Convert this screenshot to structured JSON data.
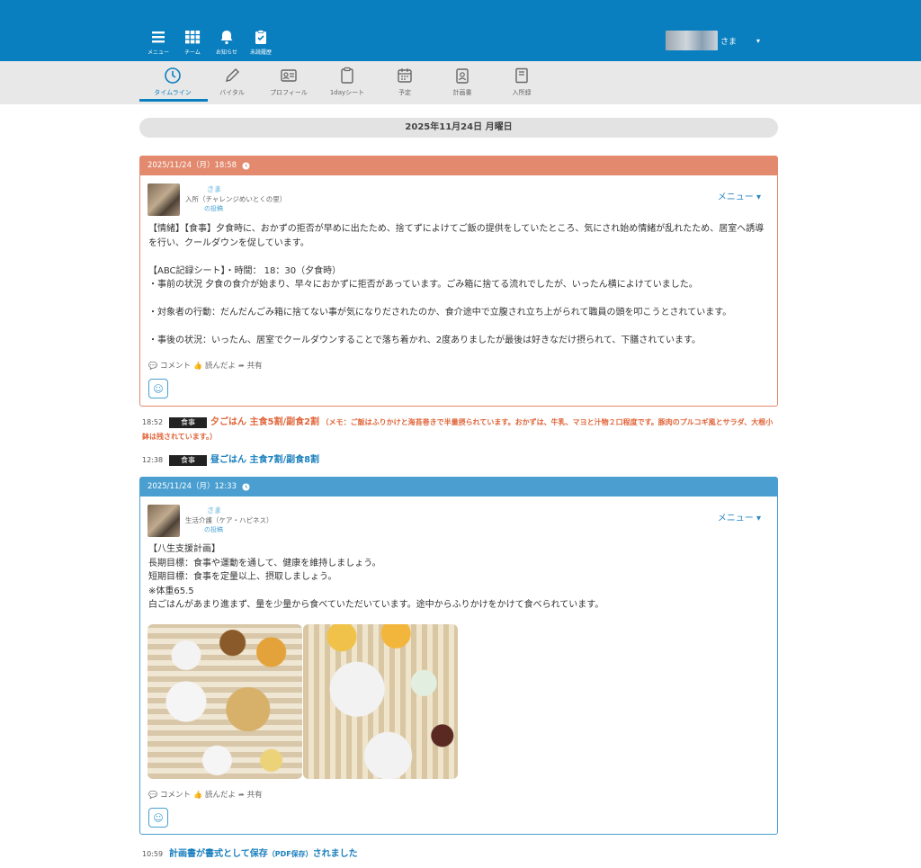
{
  "topnav": [
    {
      "label": "メニュー",
      "icon": "menu-icon"
    },
    {
      "label": "チーム",
      "icon": "grid-icon"
    },
    {
      "label": "お知らせ",
      "icon": "bell-icon"
    },
    {
      "label": "未読履歴",
      "icon": "clipboard-check-icon"
    }
  ],
  "user": {
    "suffix": "さま",
    "caret": "▾"
  },
  "tabs": [
    {
      "label": "タイムライン",
      "icon": "clock-icon",
      "active": true
    },
    {
      "label": "バイタル",
      "icon": "pen-icon"
    },
    {
      "label": "プロフィール",
      "icon": "id-card-icon"
    },
    {
      "label": "1dayシート",
      "icon": "clipboard-icon"
    },
    {
      "label": "予定",
      "icon": "calendar-icon"
    },
    {
      "label": "計画書",
      "icon": "badge-icon"
    },
    {
      "label": "入所録",
      "icon": "book-icon"
    }
  ],
  "date_header": "2025年11月24日 月曜日",
  "posts": [
    {
      "datetime": "2025/11/24（月）18:58",
      "name": "　　　さま",
      "facility": "入所（チャレンジめいとくの里）",
      "posted_by": "の投稿",
      "menu": "メニュー ▾",
      "body": "【情緒】【食事】夕食時に、おかずの拒否が早めに出たため、捨てずによけてご飯の提供をしていたところ、気にされ始め情緒が乱れたため、居室へ誘導を行い、クールダウンを促しています。\n\n【ABC記録シート】・時間： 18：30（夕食時）\n・事前の状況 夕食の食介が始まり、早々におかずに拒否があっています。ごみ箱に捨てる流れでしたが、いったん横によけていました。\n\n・対象者の行動：だんだんごみ箱に捨てない事が気になりだされたのか、食介途中で立腹され立ち上がられて職員の頭を叩こうとされています。\n\n・事後の状況：いったん、居室でクールダウンすることで落ち着かれ、2度ありましたが最後は好きなだけ摂られて、下膳されています。",
      "actions": {
        "comment": "コメント",
        "read": "読んだよ",
        "share": "共有"
      }
    },
    {
      "datetime": "2025/11/24（月）12:33",
      "name": "　　　さま",
      "facility": "生活介護（ケア・ハピネス）",
      "posted_by": "の投稿",
      "menu": "メニュー ▾",
      "body": "【八生支援計画】\n長期目標：食事や運動を通して、健康を維持しましょう。\n短期目標：食事を定量以上、摂取しましょう。\n※体重65.5\n白ごはんがあまり進まず、量を少量から食べていただいています。途中からふりかけをかけて食べられています。",
      "actions": {
        "comment": "コメント",
        "read": "読んだよ",
        "share": "共有"
      }
    }
  ],
  "timeline": [
    {
      "time": "18:52",
      "tag": "食事",
      "main": "夕ごはん 主食5割/副食2割",
      "memo": "（メモ：ご飯はふりかけと海苔巻きで半量摂られています。おかずは、牛乳、マヨと汁物２口程度です。豚肉のプルコギ風とサラダ、大根小鉢は残されています。）"
    },
    {
      "time": "12:38",
      "tag": "食事",
      "main": "昼ごはん 主食7割/副食8割"
    },
    {
      "time": "10:59",
      "main_a": "計画書が書式として保存",
      "main_b": "（PDF保存）",
      "main_c": "されました"
    }
  ],
  "colors": {
    "brand": "#0a7fbf",
    "card1": "#e2896e",
    "card2": "#4a9fd0",
    "meal_text": "#e0653a",
    "link": "#1a7fbe"
  }
}
